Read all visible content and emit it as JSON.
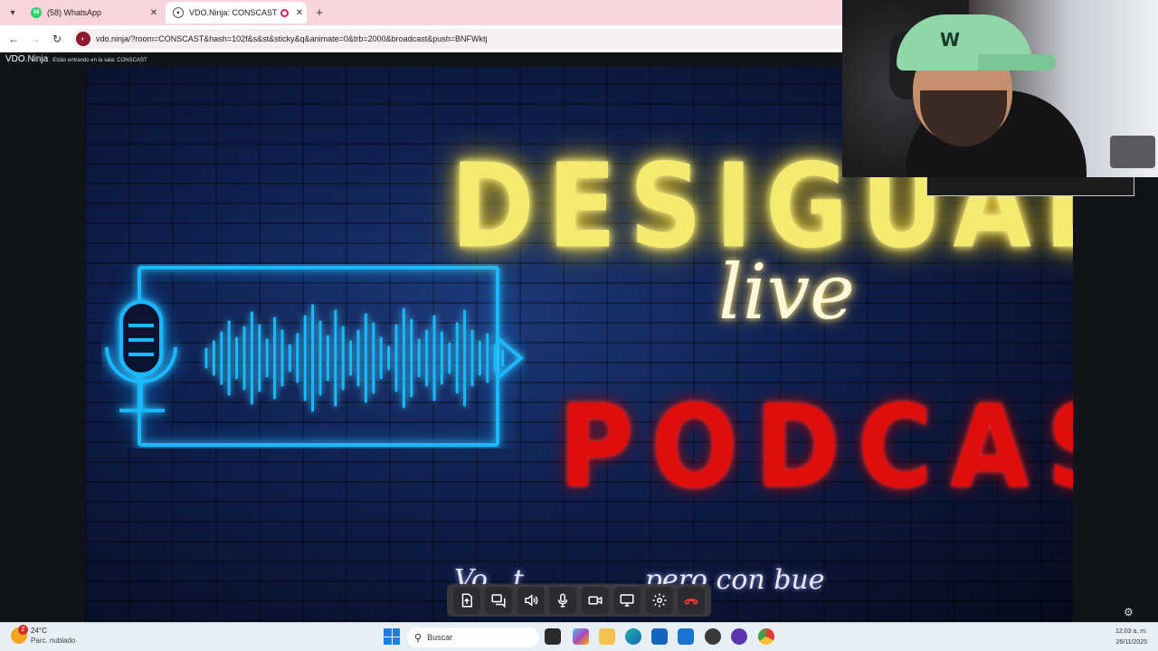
{
  "browser": {
    "tabs": [
      {
        "title": "(58) WhatsApp",
        "favicon": "whatsapp-icon",
        "badge": "58",
        "active": false
      },
      {
        "title": "VDO.Ninja: CONSCAST",
        "favicon": "ninja-icon",
        "active": true
      }
    ],
    "url": "vdo.ninja/?room=CONSCAST&hash=102f&s&st&sticky&q&animate=0&trb=2000&broadcast&push=BNFWktj"
  },
  "page": {
    "brand": "VDO.Ninja",
    "room_message": "Estás entrando en la sala: CONSCAST"
  },
  "banner": {
    "title": "DESIGUALES",
    "subtitle": "live",
    "show": "PODCAST",
    "tagline": "Vo...t............, pero con bue",
    "colors": {
      "title": "#f5ea70",
      "show": "#e00d0d",
      "neon": "#19b9ff"
    }
  },
  "controls": [
    {
      "name": "share-file-button",
      "icon": "upload-file-icon"
    },
    {
      "name": "chat-button",
      "icon": "chat-icon"
    },
    {
      "name": "speaker-button",
      "icon": "speaker-icon"
    },
    {
      "name": "mic-button",
      "icon": "microphone-icon"
    },
    {
      "name": "camera-button",
      "icon": "video-camera-icon"
    },
    {
      "name": "screen-share-button",
      "icon": "monitor-icon"
    },
    {
      "name": "settings-button",
      "icon": "gear-icon"
    },
    {
      "name": "hangup-button",
      "icon": "phone-hangup-icon"
    }
  ],
  "taskbar": {
    "weather_temp": "24°C",
    "weather_desc": "Parc. nublado",
    "weather_badge": "2",
    "search_placeholder": "Buscar",
    "time": "12:03 a. m.",
    "date": "26/11/2025"
  }
}
